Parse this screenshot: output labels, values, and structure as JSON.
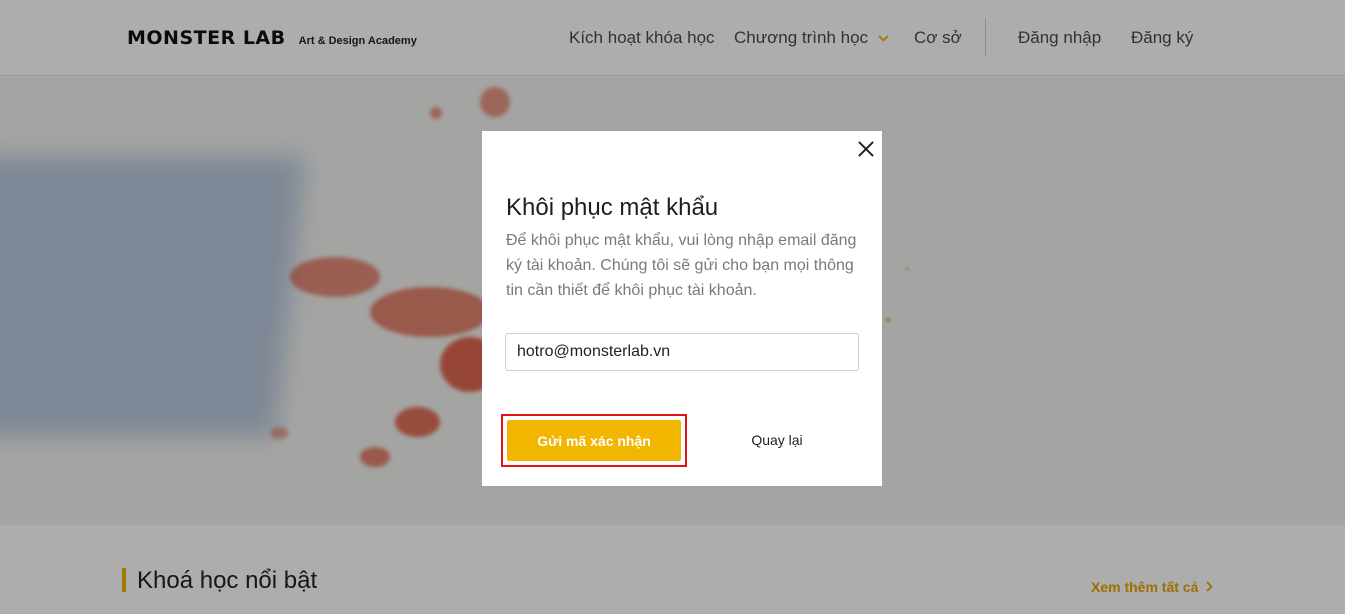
{
  "header": {
    "logo_main": "MONSTER LAB",
    "logo_sub": "Art & Design Academy",
    "nav": {
      "activate": "Kích hoạt khóa học",
      "programs": "Chương trình học",
      "campus": "Cơ sở",
      "login": "Đăng nhập",
      "register": "Đăng ký"
    }
  },
  "section": {
    "title": "Khoá học nổi bật",
    "see_all": "Xem thêm tất cả"
  },
  "modal": {
    "title": "Khôi phục mật khẩu",
    "description": "Để khôi phục mật khẩu, vui lòng nhập email đăng ký tài khoản. Chúng tôi sẽ gửi cho bạn mọi thông tin cần thiết để khôi phục tài khoản.",
    "email_value": "hotro@monsterlab.vn",
    "send_label": "Gửi mã xác nhận",
    "back_label": "Quay lại"
  },
  "colors": {
    "accent": "#f2b600",
    "highlight": "#e0131a"
  }
}
